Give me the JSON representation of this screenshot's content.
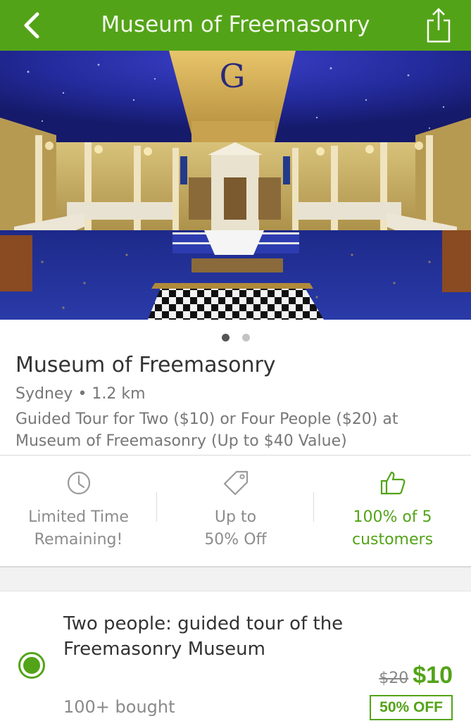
{
  "header": {
    "title": "Museum of Freemasonry",
    "back_icon": "chevron-left-icon",
    "share_icon": "share-icon",
    "bg_color": "#53a318"
  },
  "gallery": {
    "image_description": "Interior of a masonic lodge room with blue starry ceiling and checkered floor",
    "ceiling_letter": "G",
    "page_count": 2,
    "current_page": 1
  },
  "deal": {
    "title": "Museum of Freemasonry",
    "location": "Sydney • 1.2 km",
    "subtitle": "Guided Tour for Two ($10) or Four People ($20) at Museum of Freemasonry (Up to $40 Value)"
  },
  "stats": [
    {
      "icon": "clock-icon",
      "label": "Limited Time\nRemaining!"
    },
    {
      "icon": "tag-icon",
      "label": "Up to\n50% Off"
    },
    {
      "icon": "thumbs-up-icon",
      "label": "100% of 5\ncustomers"
    }
  ],
  "option": {
    "selected": true,
    "title": "Two people: guided tour of the Freemasonry Museum",
    "bought": "100+ bought",
    "old_price": "$20",
    "new_price": "$10",
    "discount_badge": "50% OFF"
  },
  "colors": {
    "accent": "#53a318",
    "text_primary": "#333333",
    "text_secondary": "#777777"
  }
}
